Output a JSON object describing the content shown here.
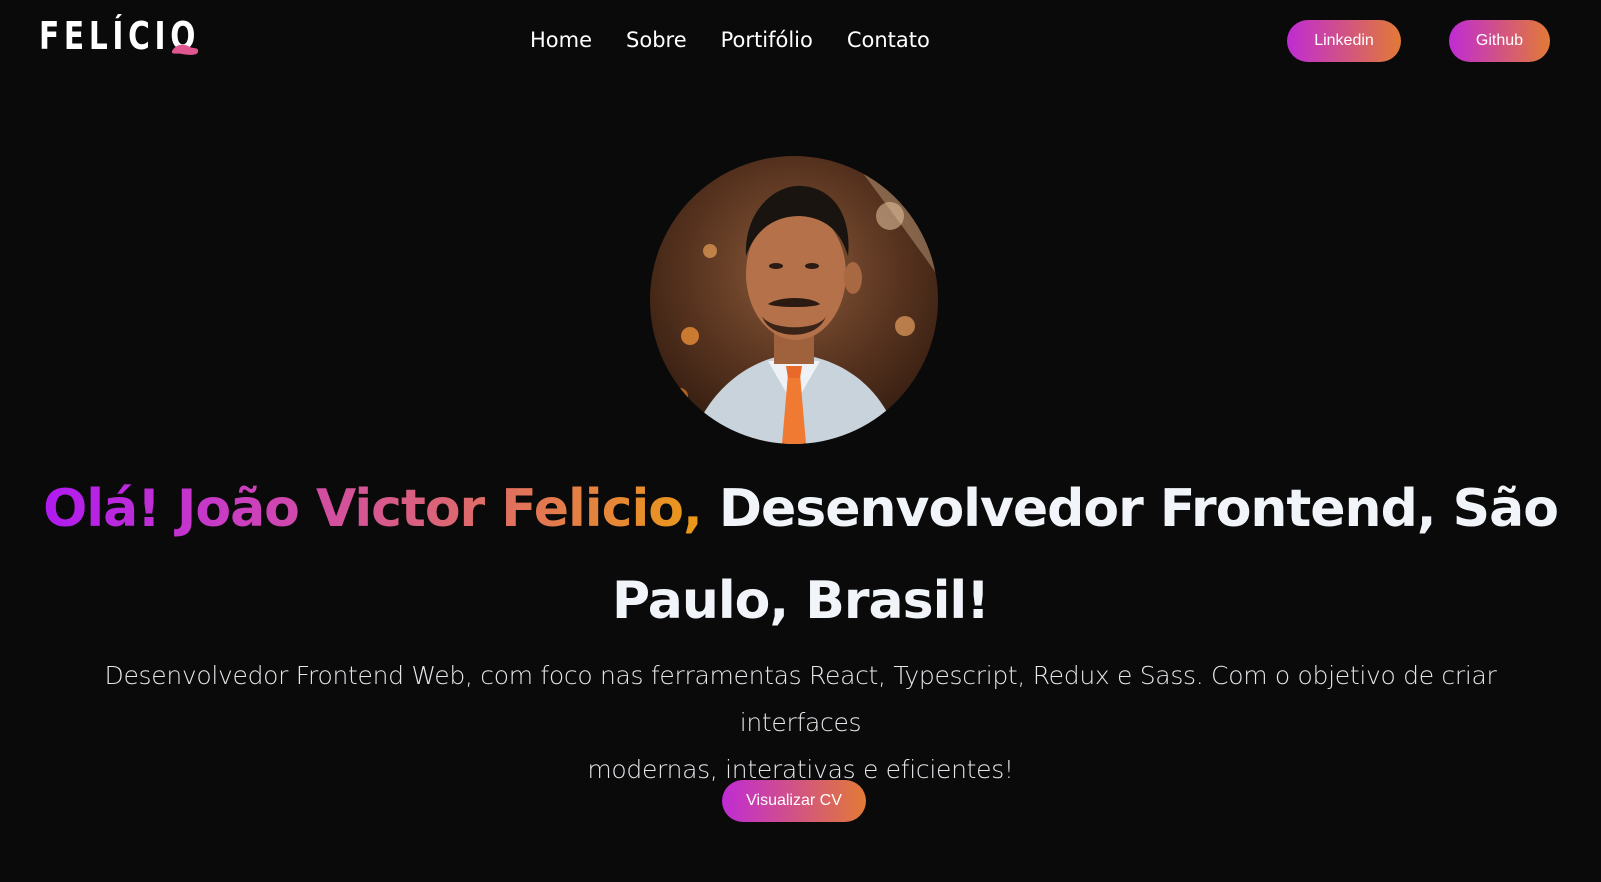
{
  "header": {
    "logo_text": "FELÍCIO",
    "nav": [
      {
        "label": "Home"
      },
      {
        "label": "Sobre"
      },
      {
        "label": "Portifólio"
      },
      {
        "label": "Contato"
      }
    ],
    "social": {
      "linkedin_label": "Linkedin",
      "github_label": "Github"
    }
  },
  "hero": {
    "avatar_alt": "",
    "headline_gradient": "Olá! João Victor Felicio,",
    "headline_white_1": "Desenvolvedor Frontend, São",
    "headline_white_2": "Paulo, Brasil!",
    "description_line_1": "Desenvolvedor Frontend Web, com foco nas ferramentas React, Typescript, Redux e Sass. Com o objetivo de criar interfaces",
    "description_line_2": "modernas, interativas e eficientes!",
    "cv_button_label": "Visualizar CV"
  },
  "colors": {
    "background": "#0a0a0b",
    "gradient_start": "#c02bd4",
    "gradient_end": "#e27a36",
    "text": "#f1f5f9"
  }
}
